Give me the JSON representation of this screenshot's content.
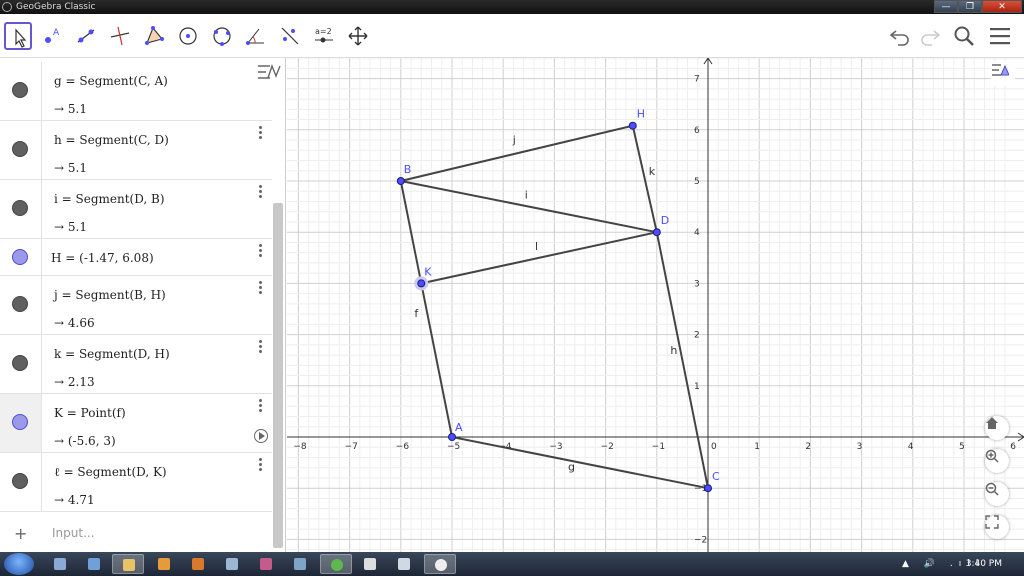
{
  "window": {
    "title": "GeoGebra Classic",
    "min": "—",
    "max": "❐",
    "close": "✕"
  },
  "toolbar": {
    "tools": [
      {
        "name": "move-tool",
        "selected": true
      },
      {
        "name": "point-tool"
      },
      {
        "name": "line-tool"
      },
      {
        "name": "perpendicular-line-tool"
      },
      {
        "name": "polygon-tool"
      },
      {
        "name": "circle-center-point-tool"
      },
      {
        "name": "circle-three-points-tool"
      },
      {
        "name": "angle-tool"
      },
      {
        "name": "reflect-tool"
      },
      {
        "name": "slider-tool",
        "label": "a=2"
      },
      {
        "name": "move-graphics-view-tool"
      }
    ]
  },
  "algebra": {
    "rows": [
      {
        "def": "g = Segment(C, A)",
        "val": "→  5.1",
        "color": "gray"
      },
      {
        "def": "h = Segment(C, D)",
        "val": "→  5.1",
        "color": "gray"
      },
      {
        "def": "i = Segment(D, B)",
        "val": "→  5.1",
        "color": "gray"
      },
      {
        "def": "H = (-1.47, 6.08)",
        "val": "",
        "color": "blue"
      },
      {
        "def": "j = Segment(B, H)",
        "val": "→  4.66",
        "color": "gray"
      },
      {
        "def": "k = Segment(D, H)",
        "val": "→  2.13",
        "color": "gray"
      },
      {
        "def": "K = Point(f)",
        "val": "→  (-5.6, 3)",
        "color": "blue"
      },
      {
        "def": "ℓ = Segment(D, K)",
        "val": "→  4.71",
        "color": "gray"
      }
    ],
    "input_placeholder": "Input...",
    "input_plus": "+"
  },
  "graphics": {
    "x_ticks": [
      "−8",
      "−7",
      "−6",
      "−5",
      "−4",
      "−3",
      "−2",
      "−1",
      "0",
      "1",
      "2",
      "3",
      "4",
      "5",
      "6"
    ],
    "y_ticks": [
      "7",
      "6",
      "5",
      "4",
      "3",
      "2",
      "1",
      "−1",
      "−2"
    ],
    "points": [
      {
        "label": "A",
        "x": -5,
        "y": 0
      },
      {
        "label": "B",
        "x": -6,
        "y": 5
      },
      {
        "label": "C",
        "x": 0,
        "y": -1
      },
      {
        "label": "D",
        "x": -1,
        "y": 4
      },
      {
        "label": "H",
        "x": -1.47,
        "y": 6.08
      },
      {
        "label": "K",
        "x": -5.6,
        "y": 3
      }
    ],
    "segments": [
      {
        "label": "g",
        "from": "C",
        "to": "A"
      },
      {
        "label": "h",
        "from": "C",
        "to": "D"
      },
      {
        "label": "i",
        "from": "D",
        "to": "B"
      },
      {
        "label": "j",
        "from": "B",
        "to": "H"
      },
      {
        "label": "k",
        "from": "D",
        "to": "H"
      },
      {
        "label": "l",
        "from": "D",
        "to": "K"
      },
      {
        "label": "f",
        "from": "A",
        "to": "B"
      }
    ],
    "colors": {
      "point": "#4d4dff",
      "segment": "#444444",
      "axis": "#333333"
    }
  },
  "taskbar": {
    "time": "3:40 PM",
    "tray_icons": "▲ 🔊 .ıll"
  }
}
